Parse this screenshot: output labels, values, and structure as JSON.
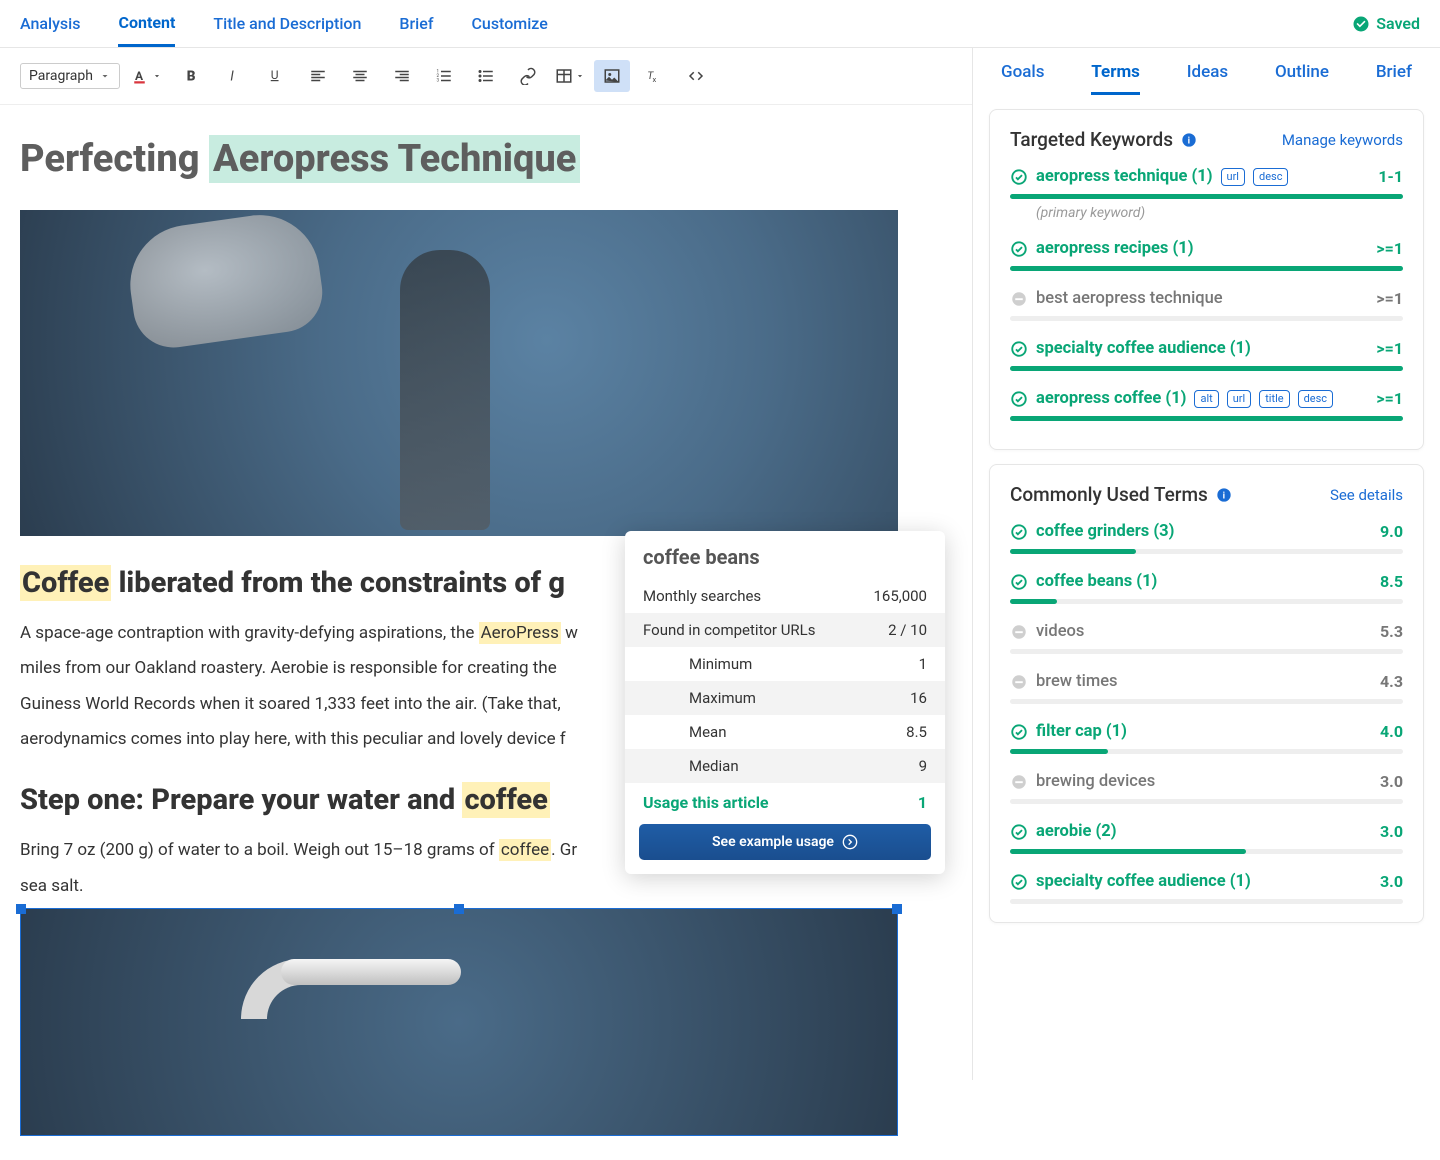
{
  "topTabs": [
    "Analysis",
    "Content",
    "Title and Description",
    "Brief",
    "Customize"
  ],
  "topTabActive": 1,
  "savedLabel": "Saved",
  "toolbar": {
    "blockType": "Paragraph"
  },
  "article": {
    "h1_pre": "Perfecting ",
    "h1_hl": "Aeropress Technique",
    "h2a_hl": "Coffee",
    "h2a_rest": " liberated from the constraints of g",
    "p1_pre": "A space-age contraption with gravity-defying aspirations, the ",
    "p1_hl": "AeroPress",
    "p1_post": " w",
    "p2": "miles from our Oakland roastery. Aerobie is responsible for creating the",
    "p3": "Guiness World Records when it soared 1,333 feet into the air. (Take that,",
    "p4": "aerodynamics comes into play here, with this peculiar and lovely device f",
    "h2b_pre": "Step one: Prepare your water and ",
    "h2b_hl": "coffee",
    "p5_pre": "Bring 7 oz (200 g) of water to a boil. Weigh out 15–18 grams of ",
    "p5_hl": "coffee",
    "p5_post": ". Gr",
    "p6": "sea salt."
  },
  "popup": {
    "title": "coffee beans",
    "rows": [
      {
        "label": "Monthly searches",
        "value": "165,000",
        "indent": false
      },
      {
        "label": "Found in competitor URLs",
        "value": "2 / 10",
        "indent": false,
        "alt": true
      },
      {
        "label": "Minimum",
        "value": "1",
        "indent": true
      },
      {
        "label": "Maximum",
        "value": "16",
        "indent": true,
        "alt": true
      },
      {
        "label": "Mean",
        "value": "8.5",
        "indent": true
      },
      {
        "label": "Median",
        "value": "9",
        "indent": true,
        "alt": true
      }
    ],
    "usageLabel": "Usage this article",
    "usageValue": "1",
    "button": "See example usage"
  },
  "sideTabs": [
    "Goals",
    "Terms",
    "Ideas",
    "Outline",
    "Brief"
  ],
  "sideTabActive": 1,
  "targeted": {
    "title": "Targeted Keywords",
    "link": "Manage keywords",
    "items": [
      {
        "status": "ok",
        "name": "aeropress technique",
        "count": "(1)",
        "badges": [
          "url",
          "desc"
        ],
        "right": "1-1",
        "fill": 100,
        "note": "(primary keyword)"
      },
      {
        "status": "ok",
        "name": "aeropress recipes",
        "count": "(1)",
        "badges": [],
        "right": ">=1",
        "fill": 100
      },
      {
        "status": "neutral",
        "name": "best aeropress technique",
        "count": "",
        "badges": [],
        "right": ">=1",
        "fill": 0
      },
      {
        "status": "ok",
        "name": "specialty coffee audience",
        "count": "(1)",
        "badges": [],
        "right": ">=1",
        "fill": 100
      },
      {
        "status": "ok",
        "name": "aeropress coffee",
        "count": "(1)",
        "badges": [
          "alt",
          "url",
          "title",
          "desc"
        ],
        "right": ">=1",
        "fill": 100
      }
    ]
  },
  "common": {
    "title": "Commonly Used Terms",
    "link": "See details",
    "items": [
      {
        "status": "ok",
        "name": "coffee grinders",
        "count": "(3)",
        "right": "9.0",
        "fill": 32
      },
      {
        "status": "ok",
        "name": "coffee beans",
        "count": "(1)",
        "right": "8.5",
        "fill": 12
      },
      {
        "status": "neutral",
        "name": "videos",
        "count": "",
        "right": "5.3",
        "fill": 0
      },
      {
        "status": "neutral",
        "name": "brew times",
        "count": "",
        "right": "4.3",
        "fill": 0
      },
      {
        "status": "ok",
        "name": "filter cap",
        "count": "(1)",
        "right": "4.0",
        "fill": 25
      },
      {
        "status": "neutral",
        "name": "brewing devices",
        "count": "",
        "right": "3.0",
        "fill": 0
      },
      {
        "status": "ok",
        "name": "aerobie",
        "count": "(2)",
        "right": "3.0",
        "fill": 60
      },
      {
        "status": "ok",
        "name": "specialty coffee audience",
        "count": "(1)",
        "right": "3.0",
        "fill": 0
      }
    ]
  }
}
